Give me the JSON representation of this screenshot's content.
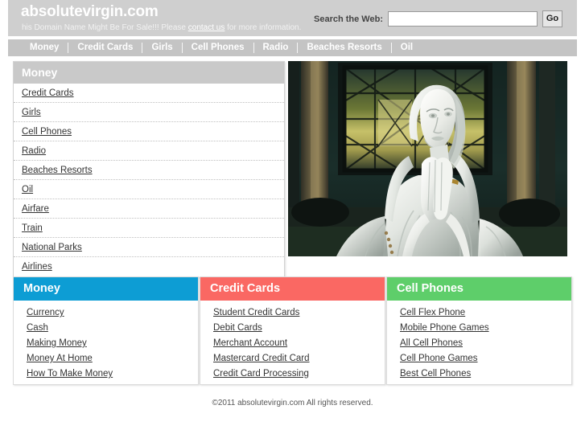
{
  "header": {
    "brand": "absolutevirgin.com",
    "tagline_before": "his Domain Name Might Be For Sale!!! Please ",
    "tagline_link": "contact us",
    "tagline_after": " for more information.",
    "search_label": "Search the Web:",
    "search_value": "",
    "search_placeholder": "",
    "go_label": "Go"
  },
  "nav": {
    "items": [
      {
        "label": "Money"
      },
      {
        "label": "Credit Cards"
      },
      {
        "label": "Girls"
      },
      {
        "label": "Cell Phones"
      },
      {
        "label": "Radio"
      },
      {
        "label": "Beaches Resorts"
      },
      {
        "label": "Oil"
      }
    ]
  },
  "category_panel": {
    "title": "Money",
    "header_color": "#c9c9c9",
    "links": [
      {
        "label": "Credit Cards"
      },
      {
        "label": "Girls"
      },
      {
        "label": "Cell Phones"
      },
      {
        "label": "Radio"
      },
      {
        "label": "Beaches Resorts"
      },
      {
        "label": "Oil"
      },
      {
        "label": "Airfare"
      },
      {
        "label": "Train"
      },
      {
        "label": "National Parks"
      },
      {
        "label": "Airlines"
      }
    ]
  },
  "photo": {
    "alt": "White stone statue of the Virgin Mary with hands pressed together in prayer, veiled head, standing before a dark church facade with a stained glass window"
  },
  "boxes": [
    {
      "title": "Money",
      "color": "#0d9dd4",
      "links": [
        {
          "label": "Currency"
        },
        {
          "label": "Cash"
        },
        {
          "label": "Making Money"
        },
        {
          "label": "Money At Home"
        },
        {
          "label": "How To Make Money"
        }
      ]
    },
    {
      "title": "Credit Cards",
      "color": "#fa6863",
      "links": [
        {
          "label": "Student Credit Cards"
        },
        {
          "label": "Debit Cards"
        },
        {
          "label": "Merchant Account"
        },
        {
          "label": "Mastercard Credit Card"
        },
        {
          "label": "Credit Card Processing"
        }
      ]
    },
    {
      "title": "Cell Phones",
      "color": "#5ece6a",
      "links": [
        {
          "label": "Cell Flex Phone"
        },
        {
          "label": "Mobile Phone Games"
        },
        {
          "label": "All Cell Phones"
        },
        {
          "label": "Cell Phone Games"
        },
        {
          "label": "Best Cell Phones"
        }
      ]
    }
  ],
  "footer": {
    "copyright": "©2011 absolutevirgin.com All rights reserved."
  }
}
